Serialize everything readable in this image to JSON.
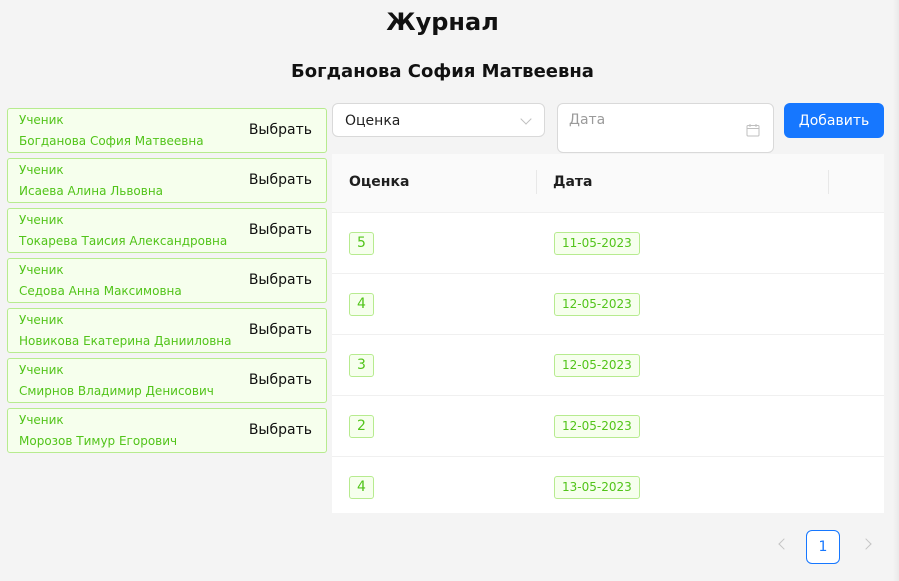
{
  "header": {
    "title": "Журнал",
    "student_name": "Богданова София Матвеевна"
  },
  "students": [
    {
      "role": "Ученик",
      "name": "Богданова София Матвеевна",
      "action": "Выбрать"
    },
    {
      "role": "Ученик",
      "name": "Исаева Алина Львовна",
      "action": "Выбрать"
    },
    {
      "role": "Ученик",
      "name": "Токарева Таисия Александровна",
      "action": "Выбрать"
    },
    {
      "role": "Ученик",
      "name": "Седова Анна Максимовна",
      "action": "Выбрать"
    },
    {
      "role": "Ученик",
      "name": "Новикова Екатерина Данииловна",
      "action": "Выбрать"
    },
    {
      "role": "Ученик",
      "name": "Смирнов Владимир Денисович",
      "action": "Выбрать"
    },
    {
      "role": "Ученик",
      "name": "Морозов Тимур Егорович",
      "action": "Выбрать"
    }
  ],
  "form": {
    "grade_select_value": "Оценка",
    "date_placeholder": "Дата",
    "add_label": "Добавить",
    "accent_color": "#1677ff"
  },
  "table": {
    "columns": [
      "Оценка",
      "Дата"
    ],
    "rows": [
      {
        "grade": "5",
        "date": "11-05-2023"
      },
      {
        "grade": "4",
        "date": "12-05-2023"
      },
      {
        "grade": "3",
        "date": "12-05-2023"
      },
      {
        "grade": "2",
        "date": "12-05-2023"
      },
      {
        "grade": "4",
        "date": "13-05-2023"
      }
    ]
  },
  "pagination": {
    "current_page": "1"
  },
  "icons": {
    "select_arrow": "chevron-down-icon",
    "date": "calendar-icon",
    "prev": "chevron-left-icon",
    "next": "chevron-right-icon"
  }
}
